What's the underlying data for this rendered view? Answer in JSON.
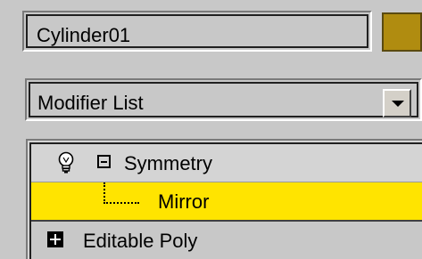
{
  "object": {
    "name": "Cylinder01",
    "color": "#b08c10"
  },
  "modifier_list": {
    "label": "Modifier List"
  },
  "stack": {
    "items": [
      {
        "label": "Symmetry",
        "expanded": true,
        "icon": "lightbulb-icon"
      },
      {
        "label": "Mirror",
        "selected": true,
        "highlight_color": "#ffe400"
      },
      {
        "label": "Editable Poly",
        "expanded": false
      }
    ]
  }
}
